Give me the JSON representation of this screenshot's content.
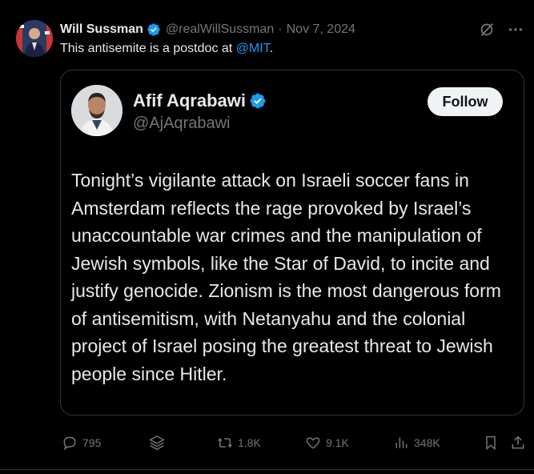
{
  "author": {
    "name": "Will Sussman",
    "handle": "@realWillSussman",
    "separator": "·",
    "date": "Nov 7, 2024"
  },
  "tweet": {
    "text_prefix": "This antisemite is a postdoc at ",
    "mention": "@MIT",
    "text_suffix": "."
  },
  "quote": {
    "name": "Afif Aqrabawi",
    "handle": "@AjAqrabawi",
    "follow_label": "Follow",
    "body": "Tonight’s vigilante attack on Israeli soccer fans in Amsterdam reflects the rage provoked by Israel’s unaccountable war crimes and the manipulation of Jewish symbols, like the Star of David, to incite and justify genocide. Zionism is the most dangerous form of antisemitism, with Netanyahu and the colonial project of Israel posing the greatest threat to Jewish people since Hitler."
  },
  "actions": {
    "replies": "795",
    "reposts": "1.8K",
    "likes": "9.1K",
    "views": "348K"
  },
  "colors": {
    "accent": "#1d9bf0",
    "muted": "#71767b",
    "text": "#e7e9ea",
    "border": "#2f3336"
  }
}
